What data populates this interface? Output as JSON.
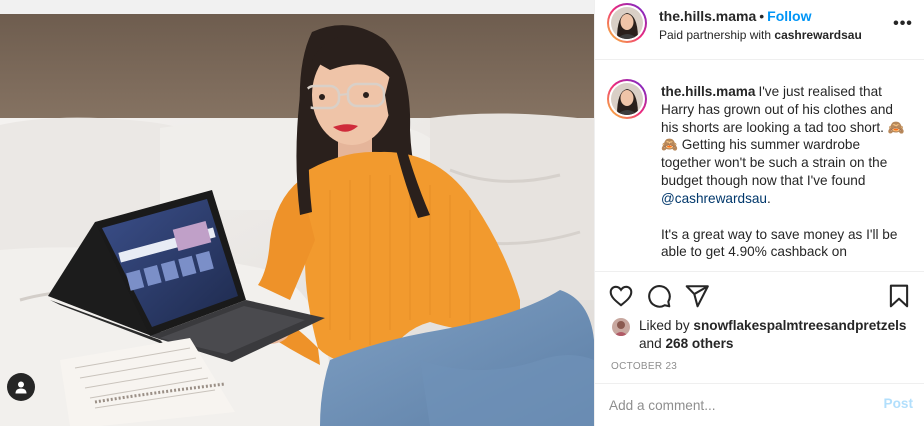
{
  "post": {
    "username": "the.hills.mama",
    "dot": "•",
    "follow_label": "Follow",
    "paid_prefix": "Paid partnership with ",
    "partner": "cashrewardsau",
    "more_label": "•••"
  },
  "caption": {
    "username": "the.hills.mama",
    "text1": "I've just realised that Harry has grown out of his clothes and his shorts are looking a tad too short. 🙈🙈 Getting his summer wardrobe together won't be such a strain on the budget though now that I've found ",
    "mention": "@cashrewardsau",
    "text1_end": ".",
    "text2": "It's a great way to save money as I'll be able to get 4.90% cashback on"
  },
  "likes": {
    "liked_by": "Liked by ",
    "liker": "snowflakespalmtreesandpretzels",
    "and": "and ",
    "others": "268 others"
  },
  "date": "OCTOBER 23",
  "comment": {
    "placeholder": "Add a comment...",
    "post_label": "Post"
  },
  "icons": {
    "like": "heart-icon",
    "comment": "comment-icon",
    "share": "share-icon",
    "save": "bookmark-icon",
    "tag": "user-tag-icon",
    "more": "more-options-icon"
  },
  "colors": {
    "follow": "#0095f6",
    "post_disabled": "#b2dffc",
    "mention": "#00376b",
    "sweater": "#f29a2e",
    "story_ring_start": "#f9ce34",
    "story_ring_mid": "#ee2a7b",
    "story_ring_end": "#6228d7"
  }
}
